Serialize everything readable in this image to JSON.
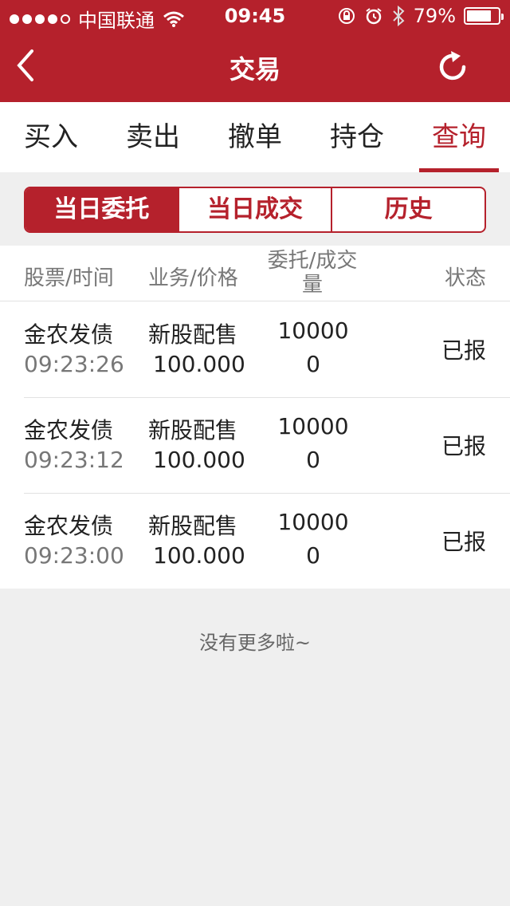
{
  "status_bar": {
    "carrier": "中国联通",
    "time": "09:45",
    "battery_text": "79%",
    "battery_level": 0.79
  },
  "nav": {
    "title": "交易"
  },
  "tabs": [
    {
      "label": "买入"
    },
    {
      "label": "卖出"
    },
    {
      "label": "撤单"
    },
    {
      "label": "持仓"
    },
    {
      "label": "查询"
    }
  ],
  "segments": [
    {
      "label": "当日委托"
    },
    {
      "label": "当日成交"
    },
    {
      "label": "历史"
    }
  ],
  "table": {
    "headers": {
      "col1": "股票/时间",
      "col2": "业务/价格",
      "col3": "委托/成交量",
      "col4": "状态"
    },
    "rows": [
      {
        "name": "金农发债",
        "time": "09:23:26",
        "business": "新股配售",
        "price": "100.000",
        "order_qty": "10000",
        "deal_qty": "0",
        "status": "已报"
      },
      {
        "name": "金农发债",
        "time": "09:23:12",
        "business": "新股配售",
        "price": "100.000",
        "order_qty": "10000",
        "deal_qty": "0",
        "status": "已报"
      },
      {
        "name": "金农发债",
        "time": "09:23:00",
        "business": "新股配售",
        "price": "100.000",
        "order_qty": "10000",
        "deal_qty": "0",
        "status": "已报"
      }
    ]
  },
  "footer": {
    "text": "没有更多啦~"
  },
  "colors": {
    "primary": "#b5212c",
    "background": "#efefef",
    "text": "#222222",
    "muted": "#777777"
  }
}
